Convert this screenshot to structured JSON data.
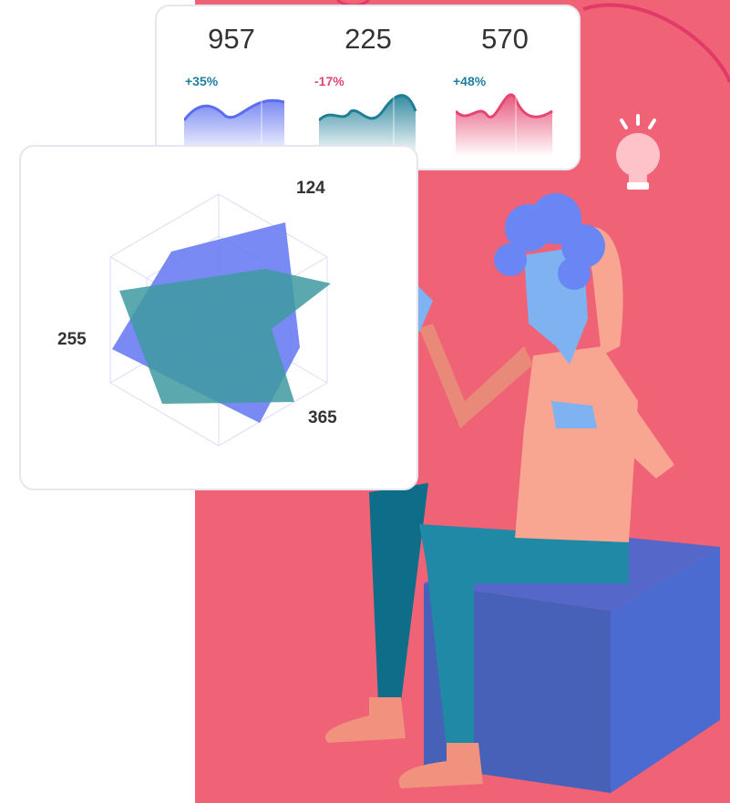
{
  "stats": [
    {
      "value": "957",
      "change": "+35%",
      "color": "#6a7cf0",
      "change_color": "#1f7fa0"
    },
    {
      "value": "225",
      "change": "-17%",
      "color": "#1f7f96",
      "change_color": "#e0457a"
    },
    {
      "value": "570",
      "change": "+48%",
      "color": "#e5466f",
      "change_color": "#1f7fa0"
    }
  ],
  "radar": {
    "labels": {
      "top": "124",
      "left": "255",
      "bottom_right": "365"
    },
    "colors": {
      "primary": "#6275f2",
      "secondary": "#3e9aa0"
    }
  },
  "illustration": {
    "background_color": "#f06275",
    "icons": [
      "lightbulb-icon"
    ]
  }
}
